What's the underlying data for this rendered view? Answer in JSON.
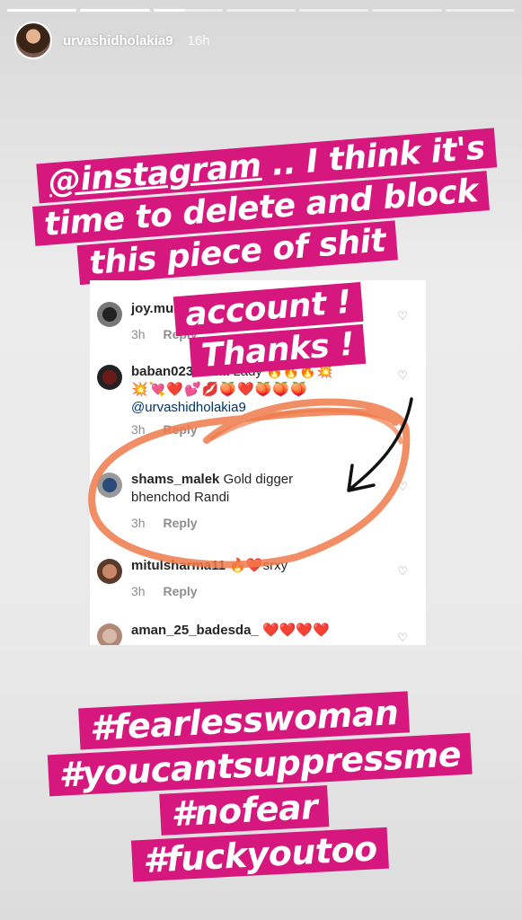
{
  "story": {
    "username": "urvashidholakia9",
    "time_ago": "16h",
    "caption_lines": [
      "@instagram .. I think it's",
      "time to delete and block",
      "this piece of shit",
      "account !",
      "Thanks !"
    ],
    "caption_mention": "@instagram",
    "caption_first_rest": " .. I think it's",
    "hashtags": [
      "#fearlesswoman",
      "#youcantsuppressme",
      "#nofear",
      "#fuckyoutoo"
    ],
    "accent_color": "#d6177d",
    "annotation_color": "#f07a4a"
  },
  "comments": [
    {
      "user": "joy.mu",
      "text": "",
      "time": "3h",
      "reply": "Reply"
    },
    {
      "user": "baban023",
      "text": "Hotttt Lady 🔥🔥🔥💥",
      "text2": "💥💘❤️💕💋🍑❤️🍑🍑🍑",
      "mention": "@urvashidholakia9",
      "time": "3h",
      "reply": "Reply"
    },
    {
      "user": "shams_malek",
      "text": "Gold digger",
      "text2": "bhenchod Randi",
      "time": "3h",
      "reply": "Reply"
    },
    {
      "user": "mitulsharma11",
      "text": "🔥❤️srxy",
      "time": "3h",
      "reply": "Reply"
    },
    {
      "user": "aman_25_badesda_",
      "text": "❤️❤️❤️❤️",
      "time": "",
      "reply": ""
    }
  ]
}
